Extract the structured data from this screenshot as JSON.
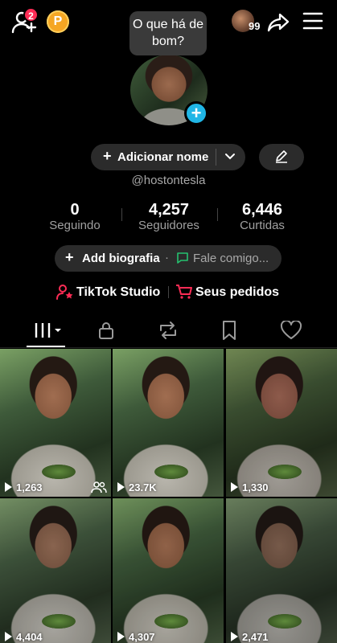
{
  "topbar": {
    "notifications_count": "2",
    "coin_letter": "P",
    "friends_count": "99"
  },
  "tooltip": {
    "text": "O que há de bom?"
  },
  "profile": {
    "add_name_label": "Adicionar nome",
    "username": "@hostontesla"
  },
  "stats": [
    {
      "value": "0",
      "label": "Seguindo"
    },
    {
      "value": "4,257",
      "label": "Seguidores"
    },
    {
      "value": "6,446",
      "label": "Curtidas"
    }
  ],
  "bio": {
    "add_bio_label": "Add biografia",
    "separator": "·",
    "chat_label": "Fale comigo..."
  },
  "links": {
    "studio_label": "TikTok Studio",
    "orders_label": "Seus pedidos"
  },
  "tabs": [
    {
      "icon": "grid-icon",
      "active": true
    },
    {
      "icon": "lock-icon",
      "active": false
    },
    {
      "icon": "repost-icon",
      "active": false
    },
    {
      "icon": "bookmark-icon",
      "active": false
    },
    {
      "icon": "heart-icon",
      "active": false
    }
  ],
  "videos": [
    {
      "views": "1,263"
    },
    {
      "views": "23.7K"
    },
    {
      "views": "1,330"
    },
    {
      "views": "4,404"
    },
    {
      "views": "4,307"
    },
    {
      "views": "2,471"
    }
  ],
  "colors": {
    "background": "#000000",
    "accent_red": "#fe2c55",
    "accent_blue": "#20b6e6",
    "pill": "#2b2b2b"
  }
}
